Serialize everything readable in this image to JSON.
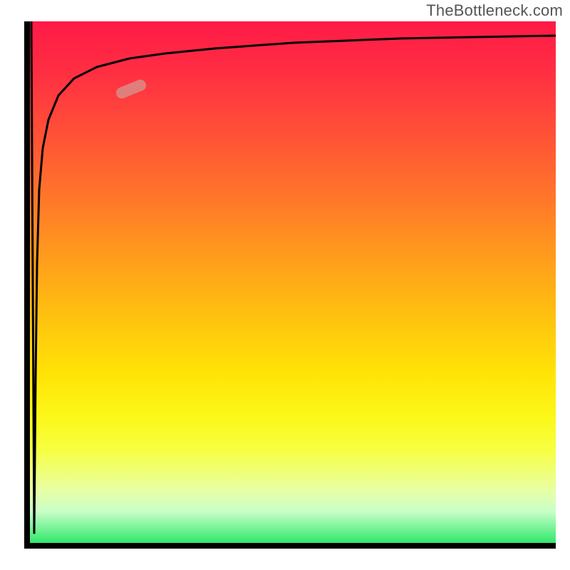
{
  "watermark": "TheBottleneck.com",
  "chart_data": {
    "type": "line",
    "title": "",
    "xlabel": "",
    "ylabel": "",
    "xlim": [
      0,
      100
    ],
    "ylim": [
      0,
      100
    ],
    "legend": false,
    "grid": false,
    "background": {
      "kind": "vertical-gradient",
      "stops": [
        {
          "pos": 0.0,
          "color": "#ff1a46"
        },
        {
          "pos": 0.5,
          "color": "#ffc60e"
        },
        {
          "pos": 0.8,
          "color": "#f7ff40"
        },
        {
          "pos": 1.0,
          "color": "#30e86c"
        }
      ]
    },
    "series": [
      {
        "name": "bottleneck-curve",
        "color": "#000000",
        "x": [
          0,
          0.5,
          1,
          1.5,
          2,
          3,
          5,
          8,
          12,
          18,
          25,
          35,
          50,
          70,
          100
        ],
        "y": [
          100,
          2,
          30,
          55,
          68,
          78,
          85,
          89,
          91.5,
          93,
          94,
          95,
          96,
          96.7,
          97.3
        ]
      }
    ],
    "marker": {
      "name": "highlight-point",
      "x": 18,
      "y": 87,
      "color": "#d98c86",
      "shape": "rounded-capsule"
    }
  }
}
